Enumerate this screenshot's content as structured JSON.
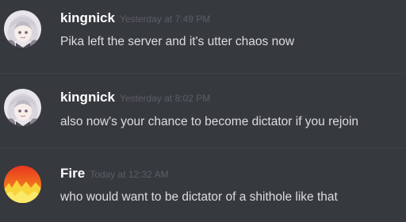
{
  "messages": [
    {
      "username": "kingnick",
      "timestamp": "Yesterday at 7:49 PM",
      "text": "Pika left the server and it's utter chaos now",
      "avatar": "anime-character-avatar"
    },
    {
      "username": "kingnick",
      "timestamp": "Yesterday at 8:02 PM",
      "text": "also now's your chance to become dictator if you rejoin",
      "avatar": "anime-character-avatar"
    },
    {
      "username": "Fire",
      "timestamp": "Today at 12:32 AM",
      "text": "who would want to be dictator of a shithole like that",
      "avatar": "fire-avatar"
    }
  ],
  "colors": {
    "background": "#36393e",
    "username": "#ffffff",
    "timestamp": "#5b5e64",
    "message_text": "#dcddde",
    "divider": "#3f4147"
  }
}
